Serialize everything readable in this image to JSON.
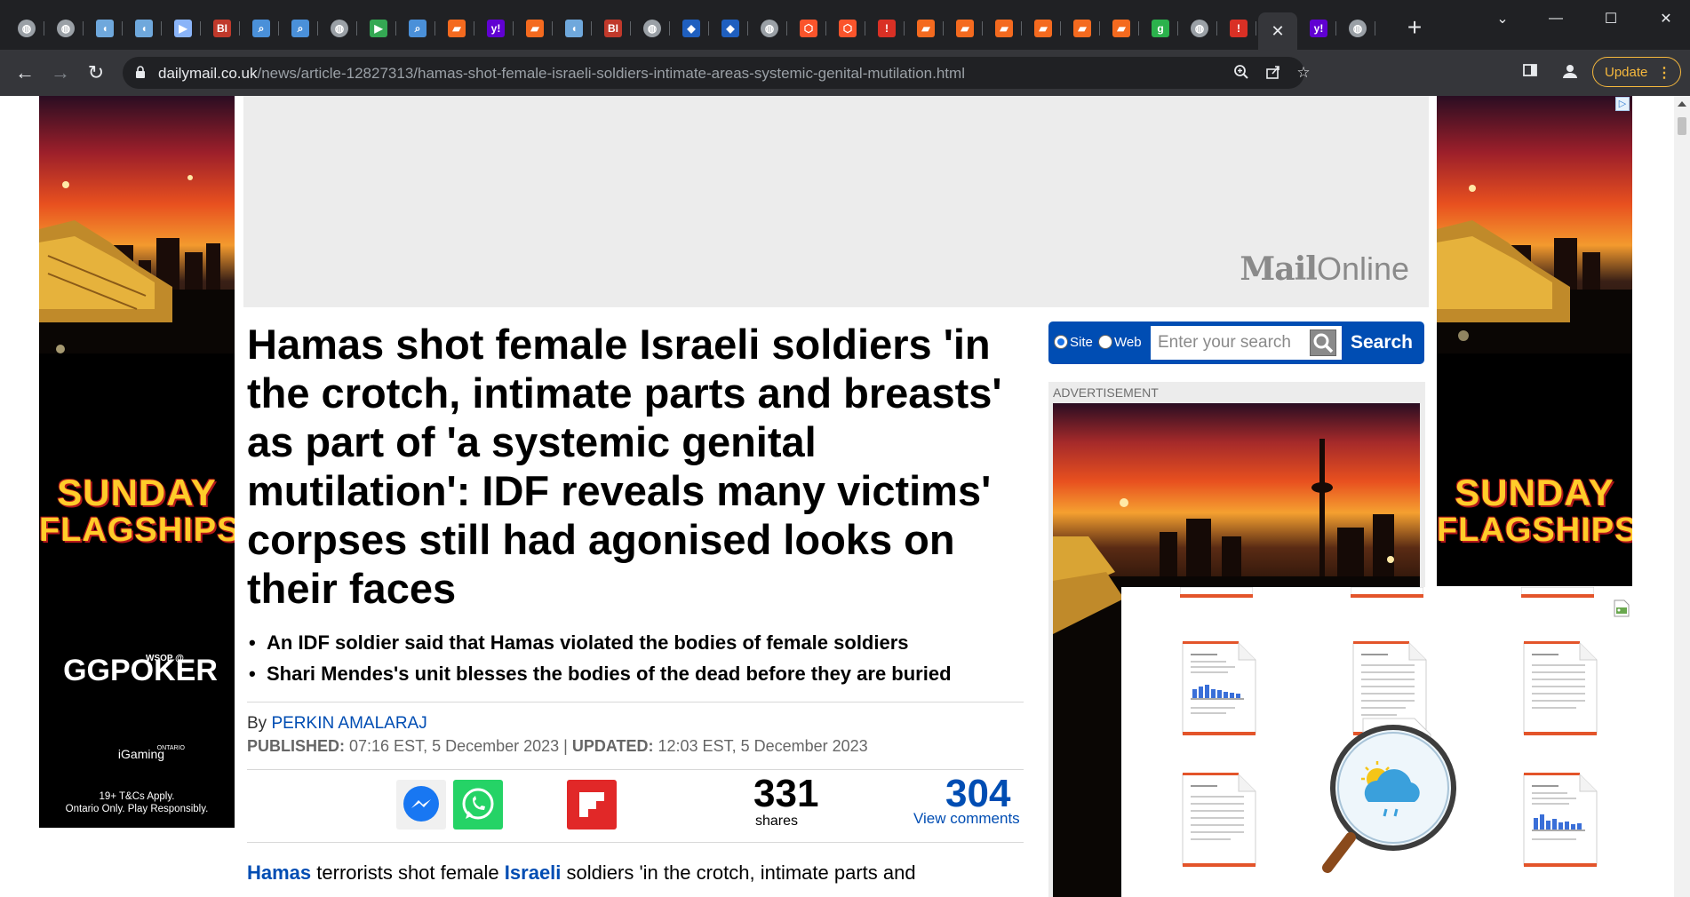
{
  "browser": {
    "active_tab_close": "✕",
    "new_tab_label": "+",
    "tabs": [
      {
        "icon": "globe-icon"
      },
      {
        "icon": "globe-icon"
      },
      {
        "icon": "shield-icon"
      },
      {
        "icon": "shield-icon"
      },
      {
        "icon": "arrow-icon"
      },
      {
        "icon": "bi-icon",
        "text": "BI"
      },
      {
        "icon": "search-icon"
      },
      {
        "icon": "search-icon"
      },
      {
        "icon": "globe-icon"
      },
      {
        "icon": "play-icon"
      },
      {
        "icon": "search-icon"
      },
      {
        "icon": "bookmark-icon"
      },
      {
        "icon": "yahoo-icon",
        "text": "y!"
      },
      {
        "icon": "bookmark-icon"
      },
      {
        "icon": "shield-icon"
      },
      {
        "icon": "bi-icon",
        "text": "BI"
      },
      {
        "icon": "globe-icon"
      },
      {
        "icon": "cube-icon"
      },
      {
        "icon": "cube-icon"
      },
      {
        "icon": "globe-icon"
      },
      {
        "icon": "brave-icon"
      },
      {
        "icon": "brave-icon"
      },
      {
        "icon": "alert-icon"
      },
      {
        "icon": "bookmark-icon"
      },
      {
        "icon": "bookmark-icon"
      },
      {
        "icon": "bookmark-icon"
      },
      {
        "icon": "bookmark-icon"
      },
      {
        "icon": "bookmark-icon"
      },
      {
        "icon": "bookmark-icon"
      },
      {
        "icon": "g-icon",
        "text": "g"
      },
      {
        "icon": "globe-icon"
      },
      {
        "icon": "alert-icon"
      },
      {
        "icon": "close-icon",
        "active": true
      },
      {
        "icon": "yahoo-icon",
        "text": "y!"
      },
      {
        "icon": "globe-icon"
      }
    ],
    "url_host": "dailymail.co.uk",
    "url_path": "/news/article-12827313/hamas-shot-female-israeli-soldiers-intimate-areas-systemic-genital-mutilation.html",
    "update_label": "Update",
    "colors": {
      "chrome_dark": "#202124",
      "toolbar": "#35363a",
      "update_accent": "#f6b83d"
    }
  },
  "ads": {
    "sky_title_line1": "SUNDAY",
    "sky_title_line2": "FLAGSHIPS",
    "sky_brand": "GGPOKER",
    "sky_brand_badge": "WSOP @",
    "sky_partner": "iGaming",
    "sky_partner_badge": "ONTARIO",
    "sky_terms_line1": "19+ T&Cs Apply.",
    "sky_terms_line2": "Ontario Only. Play Responsibly.",
    "adchoices": "▷",
    "leader_logo_bold": "Mail",
    "leader_logo_light": "Online",
    "sidebar_label": "ADVERTISEMENT"
  },
  "search": {
    "radio_site": "Site",
    "radio_web": "Web",
    "placeholder": "Enter your search",
    "button": "Search",
    "selected": "Site",
    "color": "#004db3"
  },
  "article": {
    "headline": "Hamas shot female Israeli soldiers 'in the crotch, intimate parts and breasts' as part of 'a systemic genital mutilation': IDF reveals many victims' corpses still had agonised looks on their faces",
    "bullets": [
      "An IDF soldier said that Hamas violated the bodies of female soldiers",
      "Shari Mendes's unit blesses the bodies of the dead before they are buried"
    ],
    "by_label": "By ",
    "author": "PERKIN AMALARAJ",
    "published_label": "PUBLISHED:",
    "published_value": " 07:16 EST, 5 December 2023 | ",
    "updated_label": "UPDATED:",
    "updated_value": " 12:03 EST, 5 December 2023",
    "shares_count": "331",
    "shares_label": "shares",
    "comments_count": "304",
    "comments_label": "View comments",
    "body_link1": "Hamas",
    "body_mid1": " terrorists shot female ",
    "body_link2": "Israeli",
    "body_mid2": " soldiers 'in the crotch, intimate parts and"
  }
}
